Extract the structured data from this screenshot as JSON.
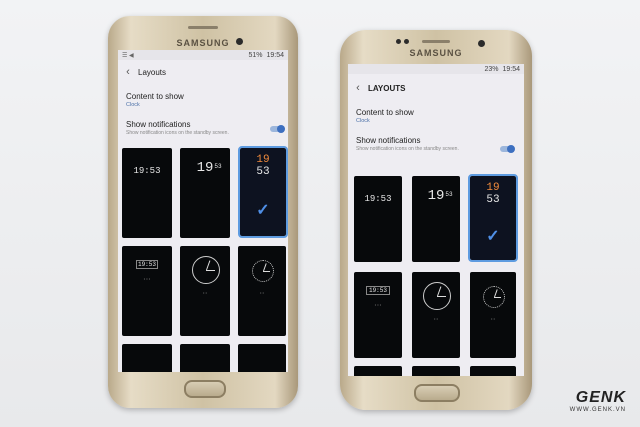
{
  "left_phone": {
    "brand": "SAMSUNG",
    "status_left": "☰ ◀",
    "status_battery": "51%",
    "status_time": "19:54",
    "title": "Layouts",
    "content_label": "Content to show",
    "content_value": "Clock",
    "notif_label": "Show notifications",
    "notif_desc": "Show notification icons on the standby screen.",
    "thumbs": [
      {
        "type": "digital",
        "time": "19:53"
      },
      {
        "type": "digital-split",
        "hh": "19",
        "mm": "53"
      },
      {
        "type": "digital-split-selected",
        "hh": "19",
        "mm": "53"
      },
      {
        "type": "box",
        "time": "19:53"
      },
      {
        "type": "analog"
      },
      {
        "type": "analog-ring"
      }
    ]
  },
  "right_phone": {
    "brand": "SAMSUNG",
    "status_battery": "23%",
    "status_time": "19:54",
    "title": "LAYOUTS",
    "content_label": "Content to show",
    "content_value": "Clock",
    "notif_label": "Show notifications",
    "notif_desc": "Show notification icons on the standby screen.",
    "thumbs": [
      {
        "type": "digital",
        "time": "19:53"
      },
      {
        "type": "digital-split",
        "hh": "19",
        "mm": "53"
      },
      {
        "type": "digital-split-selected",
        "hh": "19",
        "mm": "53"
      },
      {
        "type": "box",
        "time": "19:53"
      },
      {
        "type": "analog"
      },
      {
        "type": "analog-ring"
      }
    ]
  },
  "watermark": {
    "logo": "GENK",
    "url": "WWW.GENK.VN"
  },
  "icons": {
    "back": "back-arrow-icon",
    "check": "checkmark-icon"
  }
}
